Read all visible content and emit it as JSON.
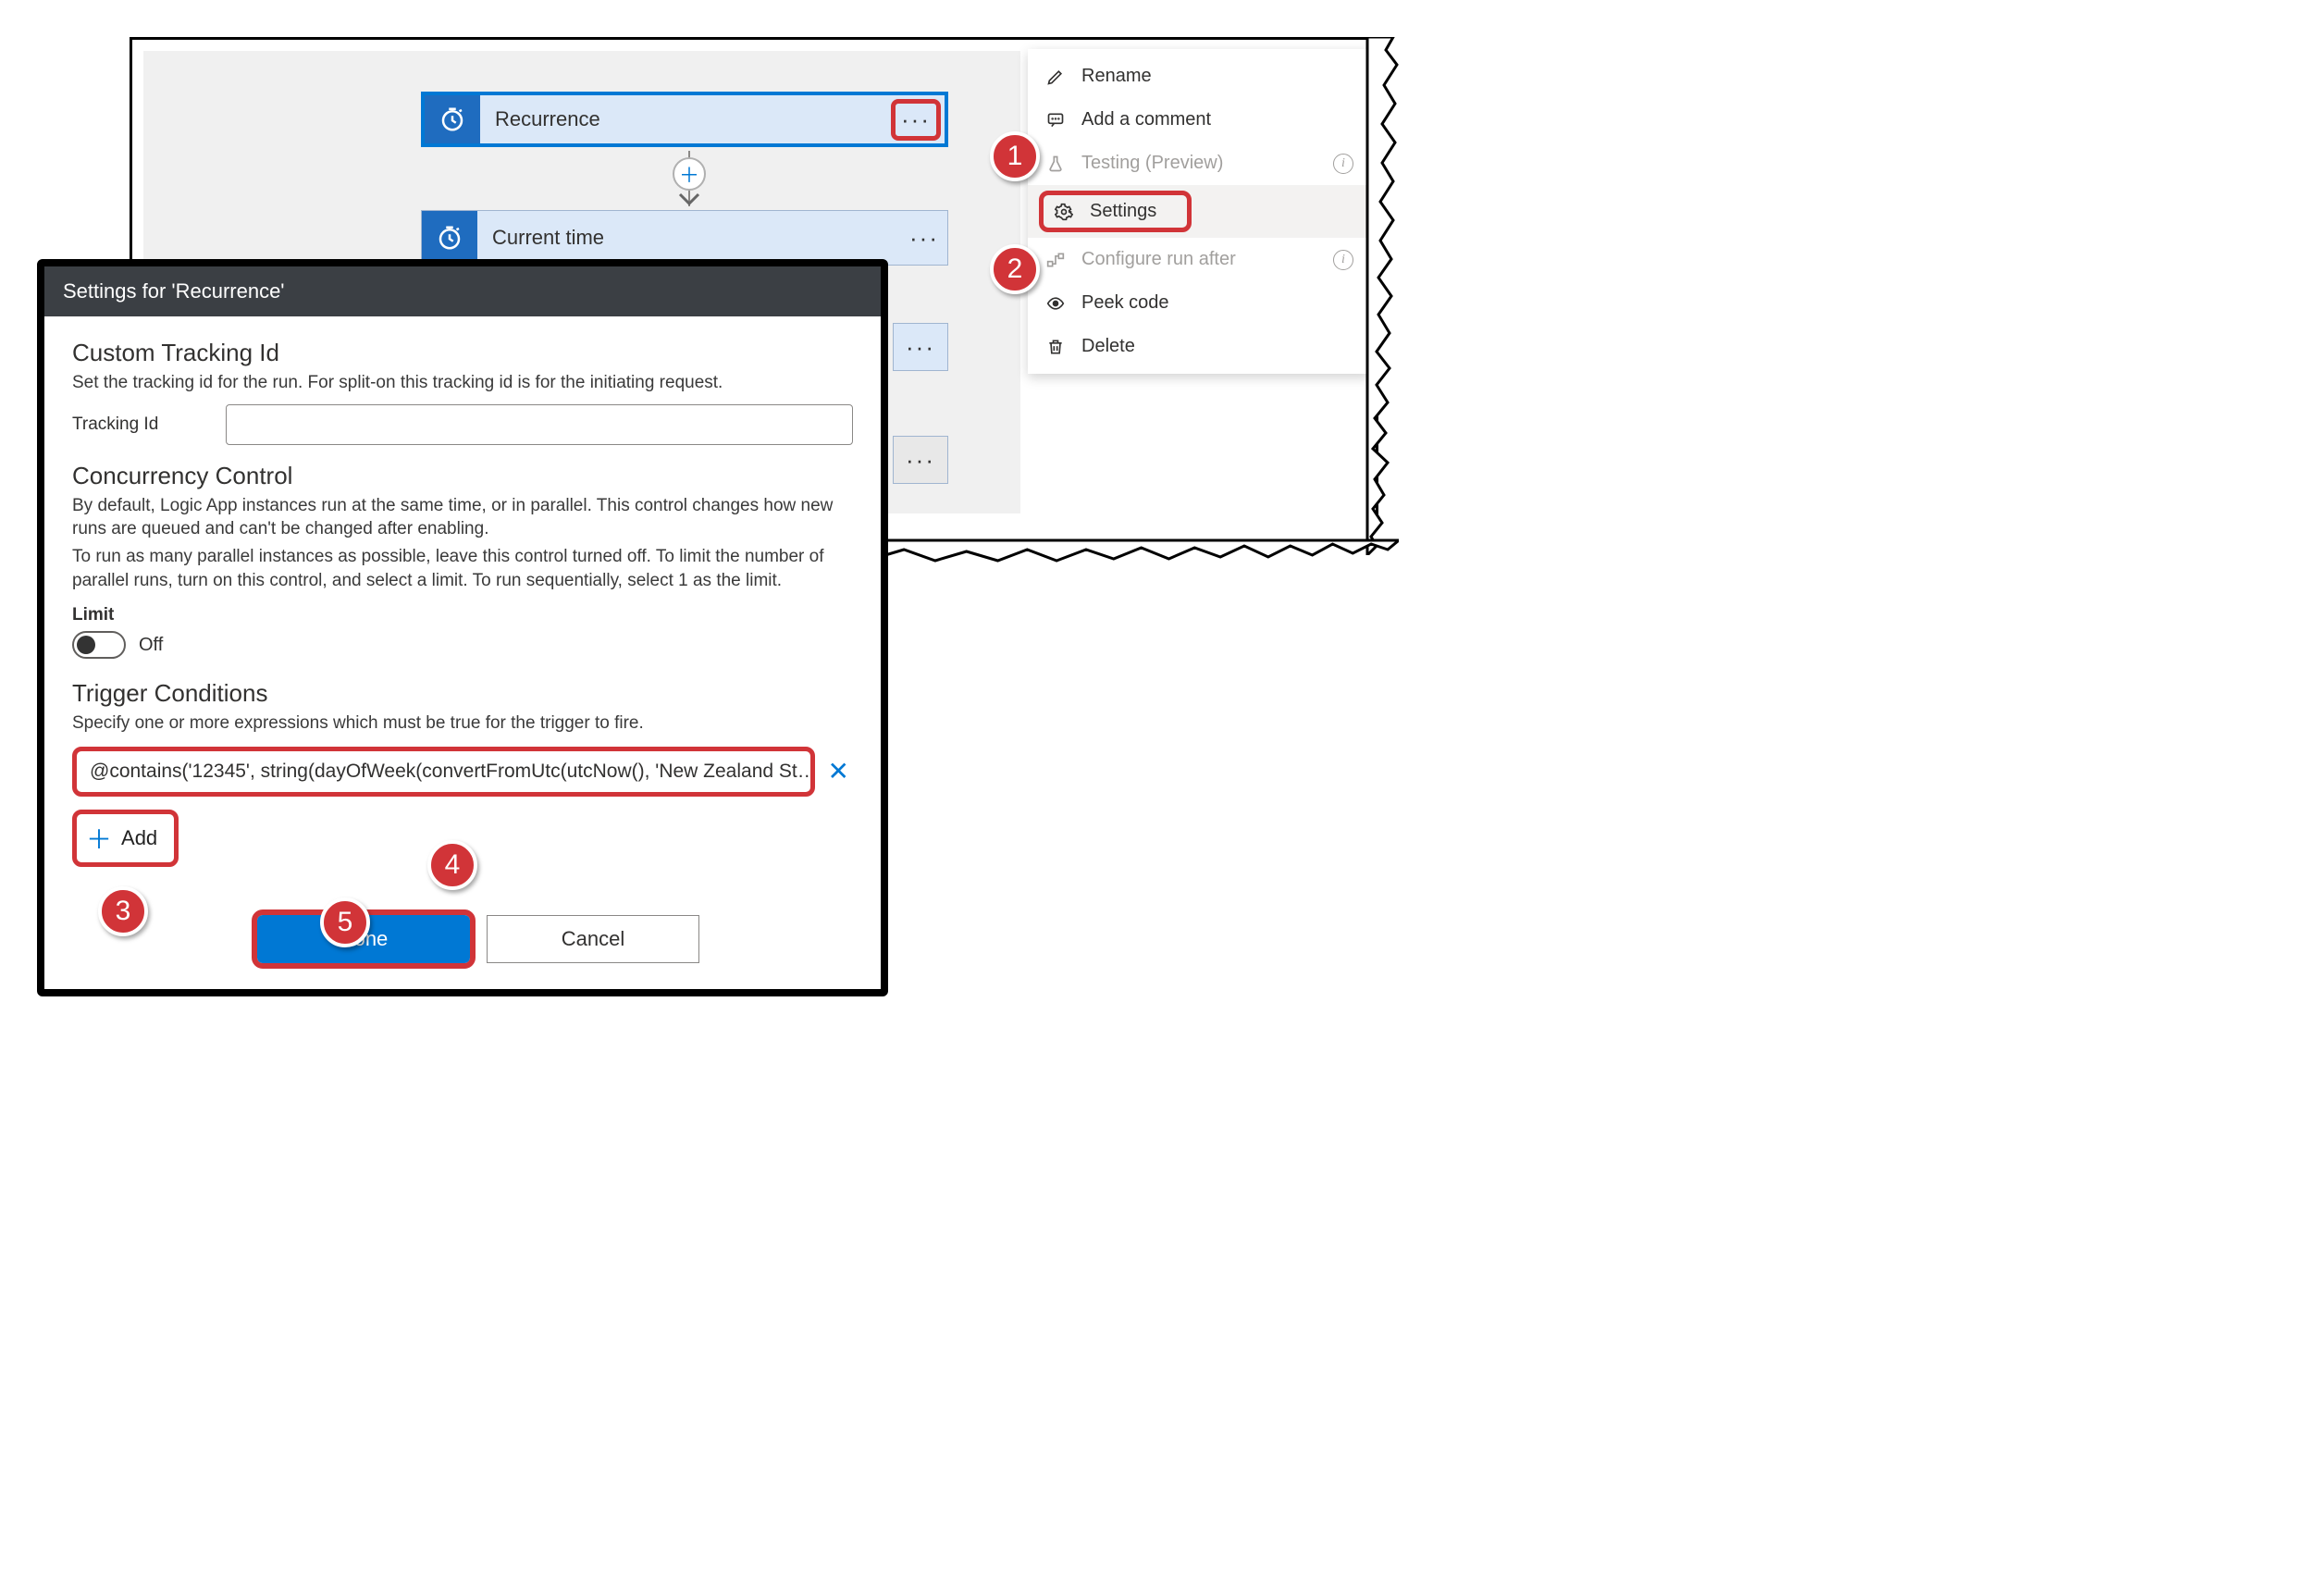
{
  "flow": {
    "cards": [
      {
        "title": "Recurrence"
      },
      {
        "title": "Current time"
      }
    ]
  },
  "menu": {
    "rename": "Rename",
    "add_comment": "Add a comment",
    "testing": "Testing (Preview)",
    "settings": "Settings",
    "configure_run_after": "Configure run after",
    "peek_code": "Peek code",
    "delete": "Delete"
  },
  "dialog": {
    "title": "Settings for 'Recurrence'",
    "tracking_heading": "Custom Tracking Id",
    "tracking_desc": "Set the tracking id for the run. For split-on this tracking id is for the initiating request.",
    "tracking_label": "Tracking Id",
    "tracking_value": "",
    "concurrency_heading": "Concurrency Control",
    "concurrency_desc1": "By default, Logic App instances run at the same time, or in parallel. This control changes how new runs are queued and can't be changed after enabling.",
    "concurrency_desc2": "To run as many parallel instances as possible, leave this control turned off. To limit the number of parallel runs, turn on this control, and select a limit. To run sequentially, select 1 as the limit.",
    "limit_label": "Limit",
    "limit_state": "Off",
    "trigger_heading": "Trigger Conditions",
    "trigger_desc": "Specify one or more expressions which must be true for the trigger to fire.",
    "condition_expr": "@contains('12345', string(dayOfWeek(convertFromUtc(utcNow(), 'New Zealand St…",
    "add_label": "Add",
    "done": "Done",
    "cancel": "Cancel"
  },
  "callouts": {
    "c1": "1",
    "c2": "2",
    "c3": "3",
    "c4": "4",
    "c5": "5"
  }
}
